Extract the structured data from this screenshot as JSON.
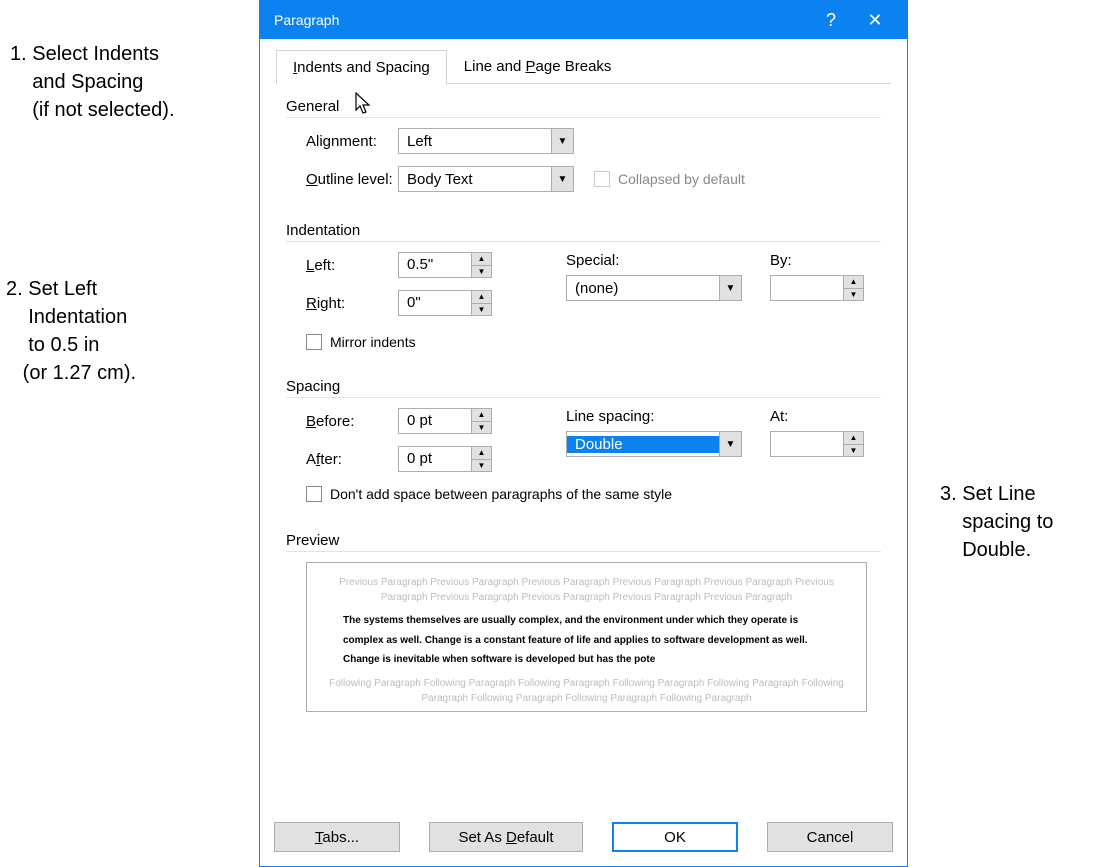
{
  "annotations": {
    "a1": "1. Select Indents\n    and Spacing\n    (if not selected).",
    "a2": "2. Set Left\n    Indentation\n    to 0.5 in\n   (or 1.27 cm).",
    "a3": "3. Set Line\n    spacing to\n    Double."
  },
  "title": "Paragraph",
  "titlebar": {
    "help": "?",
    "close": "✕"
  },
  "tabs": {
    "t1_pre": "I",
    "t1_rest": "ndents and Spacing",
    "t2_pre": "Line and ",
    "t2_u": "P",
    "t2_rest": "age Breaks"
  },
  "sections": {
    "general": "General",
    "indentation": "Indentation",
    "spacing": "Spacing",
    "preview": "Preview"
  },
  "general": {
    "alignment_pre": "Ali",
    "alignment_u": "g",
    "alignment_rest": "nment:",
    "alignment_value": "Left",
    "outline_u": "O",
    "outline_rest": "utline level:",
    "outline_value": "Body Text",
    "collapsed": "Collapsed by default"
  },
  "indent": {
    "left_u": "L",
    "left_rest": "eft:",
    "left_value": "0.5\"",
    "right_u": "R",
    "right_rest": "ight:",
    "right_value": "0\"",
    "special_u": "S",
    "special_rest": "pecial:",
    "special_value": "(none)",
    "by_rest": "B",
    "by_u": "y",
    "by_rest2": ":",
    "by_value": "",
    "mirror_u": "M",
    "mirror_rest": "irror indents"
  },
  "spacing": {
    "before_u": "B",
    "before_rest": "efore:",
    "before_value": "0 pt",
    "after_pre": "A",
    "after_u": "f",
    "after_rest": "ter:",
    "after_value": "0 pt",
    "linespacing_pre": "Li",
    "linespacing_u": "n",
    "linespacing_rest": "e spacing:",
    "linespacing_value": "Double",
    "at_u": "A",
    "at_rest": "t:",
    "at_value": "",
    "dontadd_pre": "Don't add spa",
    "dontadd_u": "c",
    "dontadd_rest": "e between paragraphs of the same style"
  },
  "preview": {
    "prev_para": "Previous Paragraph Previous Paragraph Previous Paragraph Previous Paragraph Previous Paragraph Previous Paragraph Previous Paragraph Previous Paragraph Previous Paragraph Previous Paragraph",
    "body": "The systems themselves are usually complex, and the environment under which they operate is complex as well. Change is a constant feature of life and applies to software development as well. Change is inevitable when software is developed but has the pote",
    "foll_para": "Following Paragraph Following Paragraph Following Paragraph Following Paragraph Following Paragraph Following Paragraph Following Paragraph Following Paragraph Following Paragraph"
  },
  "buttons": {
    "tabs_u": "T",
    "tabs_rest": "abs...",
    "setdefault_pre": "Set As ",
    "setdefault_u": "D",
    "setdefault_rest": "efault",
    "ok": "OK",
    "cancel": "Cancel"
  }
}
